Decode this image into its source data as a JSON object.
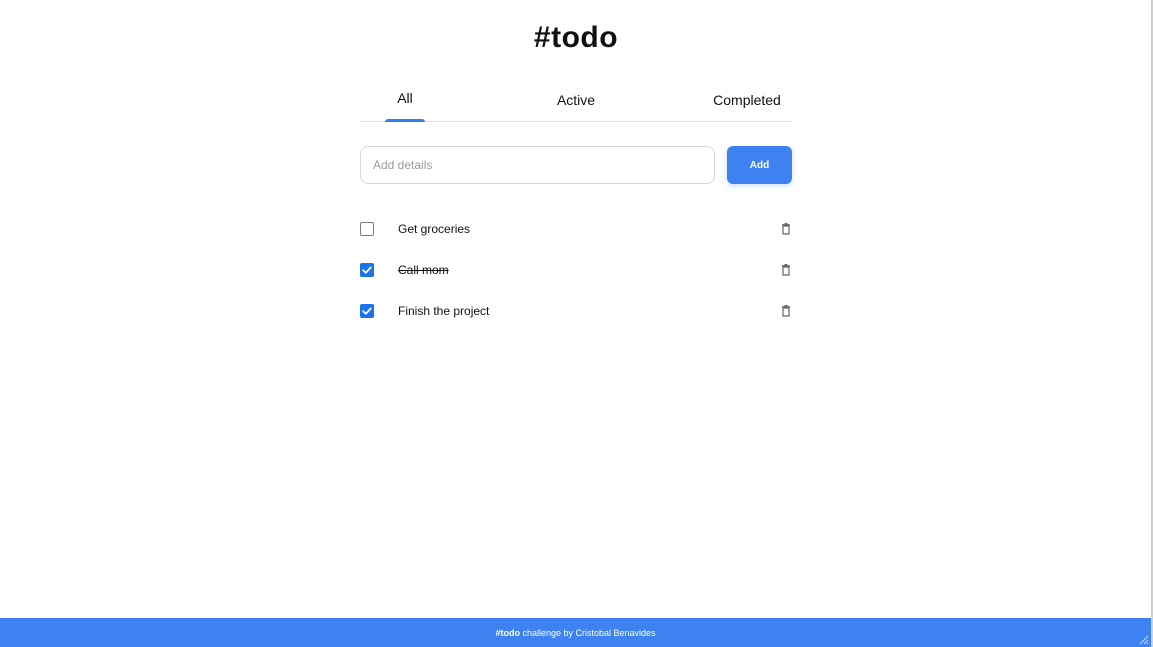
{
  "header": {
    "title": "#todo"
  },
  "tabs": [
    {
      "label": "All",
      "selected": true
    },
    {
      "label": "Active",
      "selected": false
    },
    {
      "label": "Completed",
      "selected": false
    }
  ],
  "add_form": {
    "placeholder": "Add details",
    "value": "",
    "button_label": "Add"
  },
  "todos": [
    {
      "text": "Get groceries",
      "completed": false
    },
    {
      "text": "Call mom",
      "completed": true
    },
    {
      "text": "Finish the project",
      "completed": true
    }
  ],
  "footer": {
    "brand": "#todo",
    "text": " challenge by Cristobal Benavides"
  },
  "colors": {
    "accent": "#3d82f0",
    "checkbox_checked": "#1a73e8",
    "tab_underline": "#2f80ed"
  },
  "icons": {
    "delete": "trash-icon",
    "check": "checkmark-icon"
  }
}
